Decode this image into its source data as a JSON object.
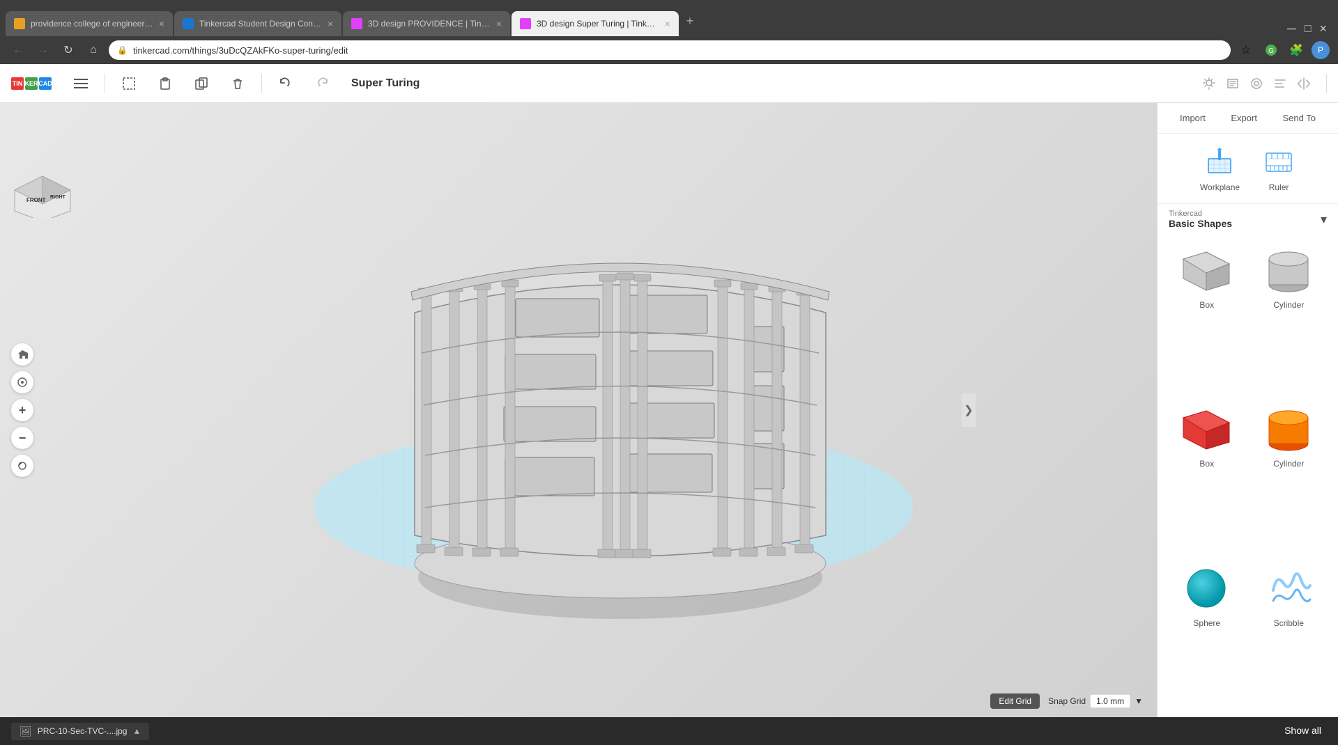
{
  "browser": {
    "tabs": [
      {
        "id": "tab1",
        "title": "providence college of engineerin...",
        "favicon_color": "#e8a020",
        "active": false
      },
      {
        "id": "tab2",
        "title": "Tinkercad Student Design Conte...",
        "favicon_color": "#1976d2",
        "active": false
      },
      {
        "id": "tab3",
        "title": "3D design PROVIDENCE | Tinker...",
        "favicon_color": "#e040fb",
        "active": false
      },
      {
        "id": "tab4",
        "title": "3D design Super Turing | Tinkerc...",
        "favicon_color": "#e040fb",
        "active": true
      }
    ],
    "address": "tinkercad.com/things/3uDcQZAkFKo-super-turing/edit"
  },
  "toolbar": {
    "title": "Super Turing",
    "undo_label": "↩",
    "redo_label": "↪"
  },
  "right_panel": {
    "import_label": "Import",
    "export_label": "Export",
    "send_to_label": "Send To",
    "workplane_label": "Workplane",
    "ruler_label": "Ruler",
    "section_provider": "Tinkercad",
    "section_title": "Basic Shapes",
    "shapes": [
      {
        "label": "Box",
        "type": "box-gray"
      },
      {
        "label": "Cylinder",
        "type": "cylinder-gray"
      },
      {
        "label": "Box",
        "type": "box-red"
      },
      {
        "label": "Cylinder",
        "type": "cylinder-orange"
      },
      {
        "label": "Sphere",
        "type": "sphere-blue"
      },
      {
        "label": "Scribble",
        "type": "scribble"
      }
    ]
  },
  "viewport": {
    "edit_grid_label": "Edit Grid",
    "snap_grid_label": "Snap Grid",
    "snap_value": "1.0 mm",
    "view_cube": {
      "front_label": "FRONT",
      "right_label": "RIGHT"
    }
  },
  "download_bar": {
    "filename": "PRC-10-Sec-TVC-....jpg",
    "show_all_label": "Show all"
  }
}
